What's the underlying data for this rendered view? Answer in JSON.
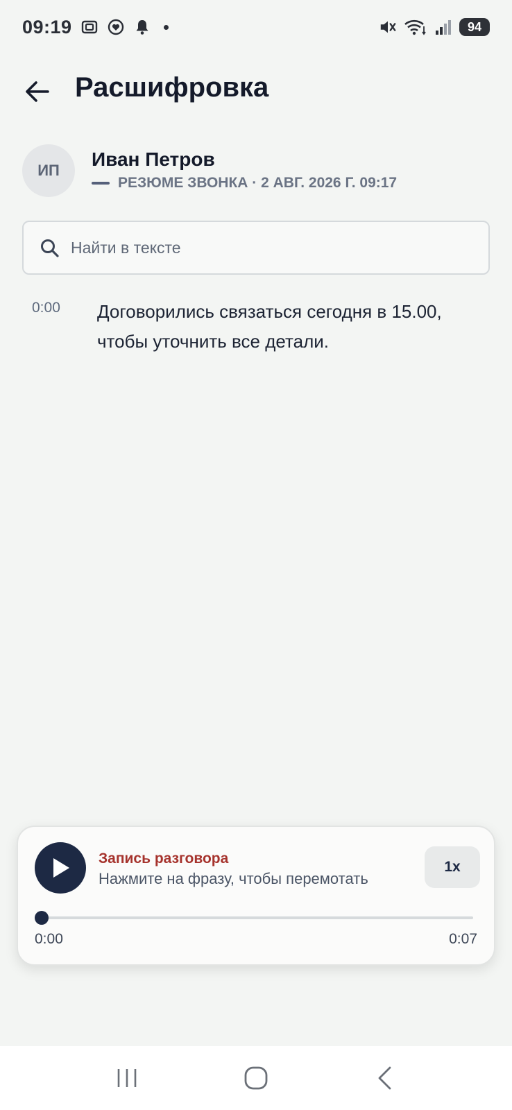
{
  "status_bar": {
    "time": "09:19",
    "battery": "94"
  },
  "header": {
    "title": "Расшифровка"
  },
  "contact": {
    "initials": "ИП",
    "name": "Иван Петров",
    "meta": "РЕЗЮМЕ ЗВОНКА · 2 АВГ. 2026 Г. 09:17"
  },
  "search": {
    "placeholder": "Найти в тексте",
    "value": ""
  },
  "transcript": [
    {
      "time": "0:00",
      "text": "Договорились связаться сегодня в 15.00, чтобы уточнить все детали."
    }
  ],
  "player": {
    "title": "Запись разговора",
    "hint": "Нажмите на фразу, чтобы перемотать",
    "speed": "1x",
    "current_time": "0:00",
    "total_time": "0:07",
    "progress_fraction": 0.0
  },
  "colors": {
    "background": "#f3f5f3",
    "accent": "#1d2944",
    "player_title": "#a6332d"
  }
}
